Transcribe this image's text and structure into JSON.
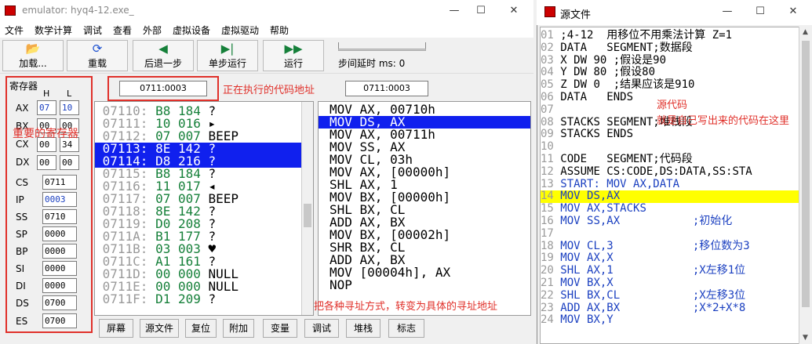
{
  "emulator": {
    "title": "emulator: hyq4-12.exe_",
    "window_controls": {
      "minimize": "—",
      "maximize": "☐",
      "close": "✕"
    },
    "menu": [
      "文件",
      "数学计算",
      "调试",
      "查看",
      "外部",
      "虚拟设备",
      "虚拟驱动",
      "帮助"
    ],
    "toolbar": [
      {
        "label": "加载...",
        "icon": "folder-open-icon",
        "glyph": "📂"
      },
      {
        "label": "重载",
        "icon": "reload-icon",
        "glyph": "⟳"
      },
      {
        "label": "后退一步",
        "icon": "step-back-icon",
        "glyph": "◀"
      },
      {
        "label": "单步运行",
        "icon": "step-forward-icon",
        "glyph": "▶|"
      },
      {
        "label": "运行",
        "icon": "run-icon",
        "glyph": "▶▶"
      }
    ],
    "step_delay_label": "步间延时 ms: 0",
    "step_delay_value": 0
  },
  "registers": {
    "title": "寄存器",
    "h_header": "H",
    "l_header": "L",
    "general": [
      {
        "name": "AX",
        "h": "07",
        "l": "10"
      },
      {
        "name": "BX",
        "h": "00",
        "l": "00"
      },
      {
        "name": "CX",
        "h": "00",
        "l": "34"
      },
      {
        "name": "DX",
        "h": "00",
        "l": "00"
      }
    ],
    "segment": [
      {
        "name": "CS",
        "value": "0711"
      },
      {
        "name": "IP",
        "value": "0003"
      },
      {
        "name": "SS",
        "value": "0710"
      },
      {
        "name": "SP",
        "value": "0000"
      },
      {
        "name": "BP",
        "value": "0000"
      },
      {
        "name": "SI",
        "value": "0000"
      },
      {
        "name": "DI",
        "value": "0000"
      },
      {
        "name": "DS",
        "value": "0700"
      },
      {
        "name": "ES",
        "value": "0700"
      }
    ],
    "annotation": "重要的寄存器"
  },
  "address": {
    "current": "0711:0003",
    "annotation": "正在执行的代码地址",
    "disasm_addr": "0711:0003"
  },
  "memory": [
    {
      "addr": "07110:",
      "hex": "B8",
      "dec": "184",
      "ch": "?"
    },
    {
      "addr": "07111:",
      "hex": "10",
      "dec": "016",
      "ch": "▸"
    },
    {
      "addr": "07112:",
      "hex": "07",
      "dec": "007",
      "ch": "BEEP"
    },
    {
      "addr": "07113:",
      "hex": "8E",
      "dec": "142",
      "ch": "?"
    },
    {
      "addr": "07114:",
      "hex": "D8",
      "dec": "216",
      "ch": "?"
    },
    {
      "addr": "07115:",
      "hex": "B8",
      "dec": "184",
      "ch": "?"
    },
    {
      "addr": "07116:",
      "hex": "11",
      "dec": "017",
      "ch": "◂"
    },
    {
      "addr": "07117:",
      "hex": "07",
      "dec": "007",
      "ch": "BEEP"
    },
    {
      "addr": "07118:",
      "hex": "8E",
      "dec": "142",
      "ch": "?"
    },
    {
      "addr": "07119:",
      "hex": "D0",
      "dec": "208",
      "ch": "?"
    },
    {
      "addr": "0711A:",
      "hex": "B1",
      "dec": "177",
      "ch": "?"
    },
    {
      "addr": "0711B:",
      "hex": "03",
      "dec": "003",
      "ch": "♥"
    },
    {
      "addr": "0711C:",
      "hex": "A1",
      "dec": "161",
      "ch": "?"
    },
    {
      "addr": "0711D:",
      "hex": "00",
      "dec": "000",
      "ch": "NULL"
    },
    {
      "addr": "0711E:",
      "hex": "00",
      "dec": "000",
      "ch": "NULL"
    },
    {
      "addr": "0711F:",
      "hex": "D1",
      "dec": "209",
      "ch": "?"
    }
  ],
  "memory_selected": [
    3,
    4
  ],
  "disasm": [
    "MOV AX, 00710h",
    "MOV DS, AX",
    "MOV AX, 00711h",
    "MOV SS, AX",
    "MOV CL, 03h",
    "MOV AX, [00000h]",
    "SHL AX, 1",
    "MOV BX, [00000h]",
    "SHL BX, CL",
    "ADD AX, BX",
    "MOV BX, [00002h]",
    "SHR BX, CL",
    "ADD AX, BX",
    "MOV [00004h], AX",
    "NOP"
  ],
  "disasm_selected": 1,
  "disasm_annotation": "把各种寻址方式，转变为具体的寻址地址",
  "bottom_buttons": [
    "屏幕",
    "源文件",
    "复位",
    "附加",
    "变量",
    "调试",
    "堆栈",
    "标志"
  ],
  "source": {
    "title": "源文件",
    "window_controls": {
      "minimize": "—",
      "maximize": "☐",
      "close": "✕"
    },
    "lines": [
      {
        "n": "01",
        "t": ";4-12  用移位不用乘法计算 Z=1"
      },
      {
        "n": "02",
        "t": "DATA   SEGMENT;数据段"
      },
      {
        "n": "03",
        "t": "X DW 90 ;假设是90"
      },
      {
        "n": "04",
        "t": "Y DW 80 ;假设80"
      },
      {
        "n": "05",
        "t": "Z DW 0  ;结果应该是910"
      },
      {
        "n": "06",
        "t": "DATA   ENDS"
      },
      {
        "n": "07",
        "t": ""
      },
      {
        "n": "08",
        "t": "STACKS SEGMENT;堆栈段"
      },
      {
        "n": "09",
        "t": "STACKS ENDS"
      },
      {
        "n": "10",
        "t": ""
      },
      {
        "n": "11",
        "t": "CODE   SEGMENT;代码段"
      },
      {
        "n": "12",
        "t": "ASSUME CS:CODE,DS:DATA,SS:STA"
      },
      {
        "n": "13",
        "t": "START: MOV AX,DATA"
      },
      {
        "n": "14",
        "t": "MOV DS,AX"
      },
      {
        "n": "15",
        "t": "MOV AX,STACKS"
      },
      {
        "n": "16",
        "t": "MOV SS,AX           ;初始化"
      },
      {
        "n": "17",
        "t": ""
      },
      {
        "n": "18",
        "t": "MOV CL,3            ;移位数为3"
      },
      {
        "n": "19",
        "t": "MOV AX,X"
      },
      {
        "n": "20",
        "t": "SHL AX,1            ;X左移1位"
      },
      {
        "n": "21",
        "t": "MOV BX,X"
      },
      {
        "n": "22",
        "t": "SHL BX,CL           ;X左移3位"
      },
      {
        "n": "23",
        "t": "ADD AX,BX           ;X*2+X*8"
      },
      {
        "n": "24",
        "t": "MOV BX,Y"
      }
    ],
    "highlight_line": 13,
    "annotation_1": "源代码",
    "annotation_2": "就是自己写出来的代码在这里"
  },
  "colors": {
    "annotation_red": "#e0302a",
    "selection_blue": "#1020ee",
    "highlight_yellow": "#ffff00",
    "hex_green": "#16803a",
    "keyword_blue": "#1a3fc0"
  }
}
